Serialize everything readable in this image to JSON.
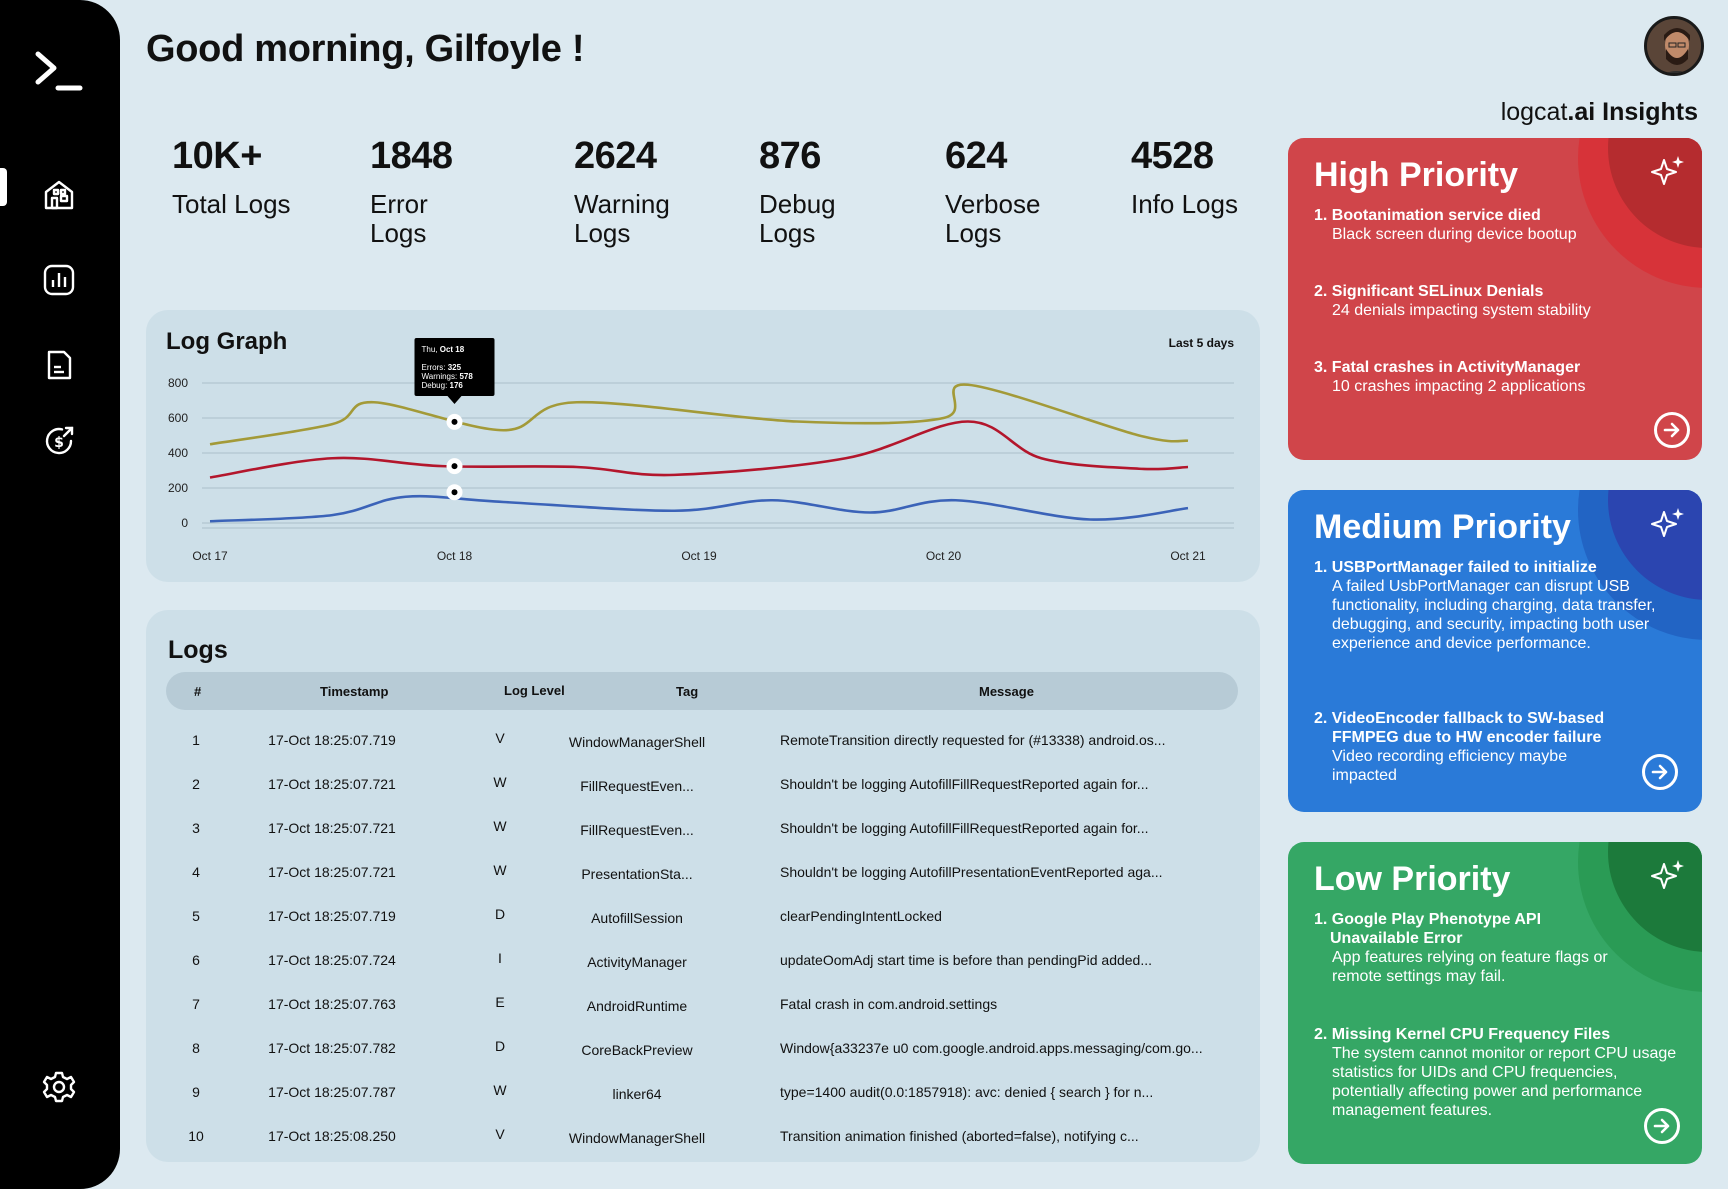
{
  "header": {
    "greeting": "Good morning, Gilfoyle !"
  },
  "insights": {
    "brand_plain": "logcat",
    "brand_bold": ".ai Insights"
  },
  "sidebar": {
    "items": [
      {
        "name": "terminal-logo-icon"
      },
      {
        "name": "home-icon"
      },
      {
        "name": "chart-icon"
      },
      {
        "name": "document-icon"
      },
      {
        "name": "dollar-refresh-icon"
      },
      {
        "name": "gear-icon"
      }
    ]
  },
  "stats": [
    {
      "value": "10K+",
      "label": "Total Logs",
      "color": "#d3e2eb"
    },
    {
      "value": "1848",
      "label": "Error Logs",
      "color": "#e3d4da"
    },
    {
      "value": "2624",
      "label": "Warning Logs",
      "color": "#dde2da"
    },
    {
      "value": "876",
      "label": "Debug Logs",
      "color": "#cbd8e6"
    },
    {
      "value": "624",
      "label": "Verbose Logs",
      "color": "#ddddf2"
    },
    {
      "value": "4528",
      "label": "Info Logs",
      "color": "#c5e4de"
    }
  ],
  "graph": {
    "title": "Log Graph",
    "range": "Last 5 days",
    "tooltip": {
      "date_prefix": "Thu, ",
      "date": "Oct 18",
      "errors_label": "Errors: ",
      "errors": "325",
      "warnings_label": "Warnings: ",
      "warnings": "578",
      "debug_label": "Debug: ",
      "debug": "176"
    }
  },
  "chart_data": {
    "type": "line",
    "title": "Log Graph",
    "x": [
      "Oct 17",
      "Oct 18",
      "Oct 19",
      "Oct 20",
      "Oct 21"
    ],
    "yticks": [
      800,
      600,
      400,
      200,
      0
    ],
    "ylim": [
      0,
      800
    ],
    "grid": true,
    "series": [
      {
        "color": "#a39a38",
        "values": [
          450,
          565,
          690,
          530,
          690,
          580,
          600,
          790,
          500,
          470
        ],
        "x_idx": [
          0,
          0.5,
          0.67,
          1.2,
          1.5,
          2.4,
          3.0,
          3.1,
          3.8,
          4.0
        ]
      },
      {
        "color": "#b3162c",
        "values": [
          260,
          370,
          325,
          320,
          275,
          370,
          580,
          370,
          310,
          320
        ],
        "x_idx": [
          0,
          0.5,
          0.95,
          1.5,
          1.9,
          2.6,
          3.1,
          3.4,
          3.8,
          4.0
        ]
      },
      {
        "color": "#3b63b8",
        "values": [
          10,
          45,
          150,
          120,
          70,
          130,
          60,
          130,
          20,
          85
        ],
        "x_idx": [
          0,
          0.5,
          0.8,
          1.2,
          1.9,
          2.3,
          2.7,
          3.05,
          3.6,
          4.0
        ]
      }
    ],
    "highlight_x_idx": 1.0,
    "highlight_values": [
      578,
      325,
      176
    ]
  },
  "logs": {
    "title": "Logs",
    "columns": [
      "#",
      "Timestamp",
      "Log Level",
      "Tag",
      "Message"
    ],
    "rows": [
      [
        "1",
        "17-Oct 18:25:07.719",
        "V",
        "WindowManagerShell",
        "RemoteTransition directly requested for (#13338) android.os..."
      ],
      [
        "2",
        "17-Oct 18:25:07.721",
        "W",
        "FillRequestEven...",
        "Shouldn't be logging AutofillFillRequestReported again for..."
      ],
      [
        "3",
        "17-Oct 18:25:07.721",
        "W",
        "FillRequestEven...",
        "Shouldn't be logging AutofillFillRequestReported again for..."
      ],
      [
        "4",
        "17-Oct 18:25:07.721",
        "W",
        "PresentationSta...",
        "Shouldn't be logging AutofillPresentationEventReported aga..."
      ],
      [
        "5",
        "17-Oct 18:25:07.719",
        "D",
        "AutofillSession",
        "clearPendingIntentLocked"
      ],
      [
        "6",
        "17-Oct 18:25:07.724",
        "I",
        "ActivityManager",
        "updateOomAdj start time is before than pendingPid added..."
      ],
      [
        "7",
        "17-Oct 18:25:07.763",
        "E",
        "AndroidRuntime",
        "Fatal crash in com.android.settings"
      ],
      [
        "8",
        "17-Oct 18:25:07.782",
        "D",
        "CoreBackPreview",
        "Window{a33237e u0 com.google.android.apps.messaging/com.go..."
      ],
      [
        "9",
        "17-Oct 18:25:07.787",
        "W",
        "linker64",
        "type=1400 audit(0.0:1857918): avc: denied { search } for n..."
      ],
      [
        "10",
        "17-Oct 18:25:08.250",
        "V",
        "WindowManagerShell",
        "Transition animation finished (aborted=false), notifying c..."
      ]
    ]
  },
  "priorities": {
    "high": {
      "title": "High Priority",
      "color": "#d0454a",
      "items": [
        {
          "n": "1.",
          "title": "Bootanimation service died",
          "desc": "Black screen during device bootup"
        },
        {
          "n": "2.",
          "title": "Significant SELinux Denials",
          "desc": "24 denials impacting system stability"
        },
        {
          "n": "3.",
          "title": "Fatal crashes in ActivityManager",
          "desc": "10 crashes impacting 2 applications"
        }
      ]
    },
    "medium": {
      "title": "Medium Priority",
      "color": "#2a7ad8",
      "items": [
        {
          "n": "1.",
          "title": "USBPortManager failed to initialize",
          "desc": "A failed UsbPortManager can disrupt USB functionality, including charging, data transfer, debugging, and security, impacting both user experience and device performance."
        },
        {
          "n": "2.",
          "title": "VideoEncoder fallback to SW-based FFMPEG due to HW encoder failure",
          "desc": "Video recording efficiency maybe impacted"
        }
      ]
    },
    "low": {
      "title": "Low Priority",
      "color": "#35a765",
      "items": [
        {
          "n": "1.",
          "title": "Google Play Phenotype API Unavailable Error",
          "desc": "App features relying on feature flags or remote settings may fail."
        },
        {
          "n": "2.",
          "title": "Missing Kernel CPU Frequency Files",
          "desc": "The system cannot monitor or report CPU usage statistics for UIDs and CPU frequencies, potentially affecting power and performance management features."
        }
      ]
    }
  }
}
